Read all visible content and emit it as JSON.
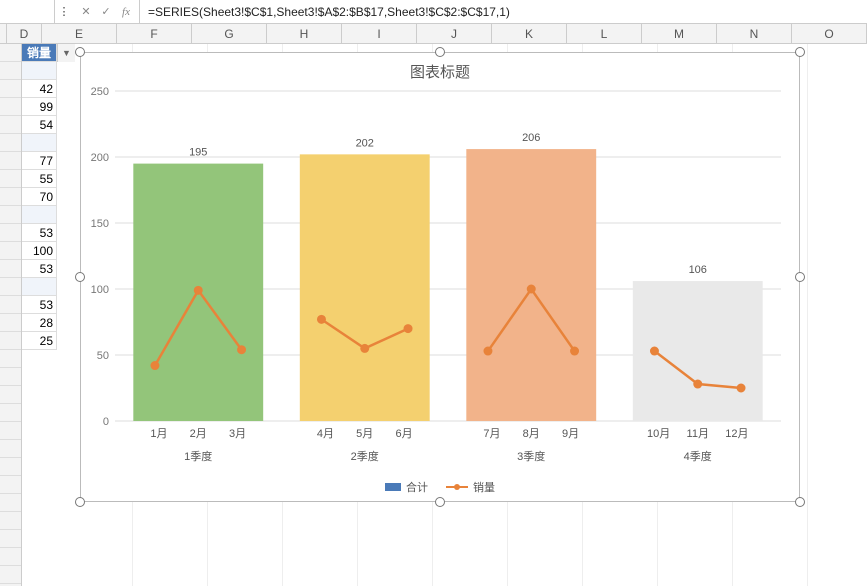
{
  "formula_bar": {
    "namebox": "",
    "fx_label": "fx",
    "drop_glyph": "⋮",
    "cancel_glyph": "✕",
    "accept_glyph": "✓",
    "formula": "=SERIES(Sheet3!$C$1,Sheet3!$A$2:$B$17,Sheet3!$C$2:$C$17,1)"
  },
  "columns": [
    "D",
    "E",
    "F",
    "G",
    "H",
    "I",
    "J",
    "K",
    "L",
    "M",
    "N",
    "O"
  ],
  "col_d": {
    "header": "销量",
    "rows": [
      "",
      "42",
      "99",
      "54",
      "",
      "77",
      "55",
      "70",
      "",
      "53",
      "100",
      "53",
      "",
      "53",
      "28",
      "25"
    ]
  },
  "dropdown_caret": "▼",
  "chart": {
    "title": "图表标题",
    "legend": {
      "series_bar": "合计",
      "series_line": "销量"
    }
  },
  "chart_data": {
    "type": "bar+line",
    "title": "图表标题",
    "ylabel": "",
    "ylim": [
      0,
      250
    ],
    "yticks": [
      0,
      50,
      100,
      150,
      200,
      250
    ],
    "groups": [
      {
        "name": "1季度",
        "months": [
          "1月",
          "2月",
          "3月"
        ],
        "total": 195,
        "sales": [
          42,
          99,
          54
        ],
        "bar_color": "#93c57a"
      },
      {
        "name": "2季度",
        "months": [
          "4月",
          "5月",
          "6月"
        ],
        "total": 202,
        "sales": [
          77,
          55,
          70
        ],
        "bar_color": "#f4d06f"
      },
      {
        "name": "3季度",
        "months": [
          "7月",
          "8月",
          "9月"
        ],
        "total": 206,
        "sales": [
          53,
          100,
          53
        ],
        "bar_color": "#f2b38a"
      },
      {
        "name": "4季度",
        "months": [
          "10月",
          "11月",
          "12月"
        ],
        "total": 106,
        "sales": [
          53,
          28,
          25
        ],
        "bar_color": "#e9e9e9"
      }
    ],
    "series": [
      {
        "name": "合计",
        "type": "bar"
      },
      {
        "name": "销量",
        "type": "line",
        "color": "#e8833a"
      }
    ]
  }
}
